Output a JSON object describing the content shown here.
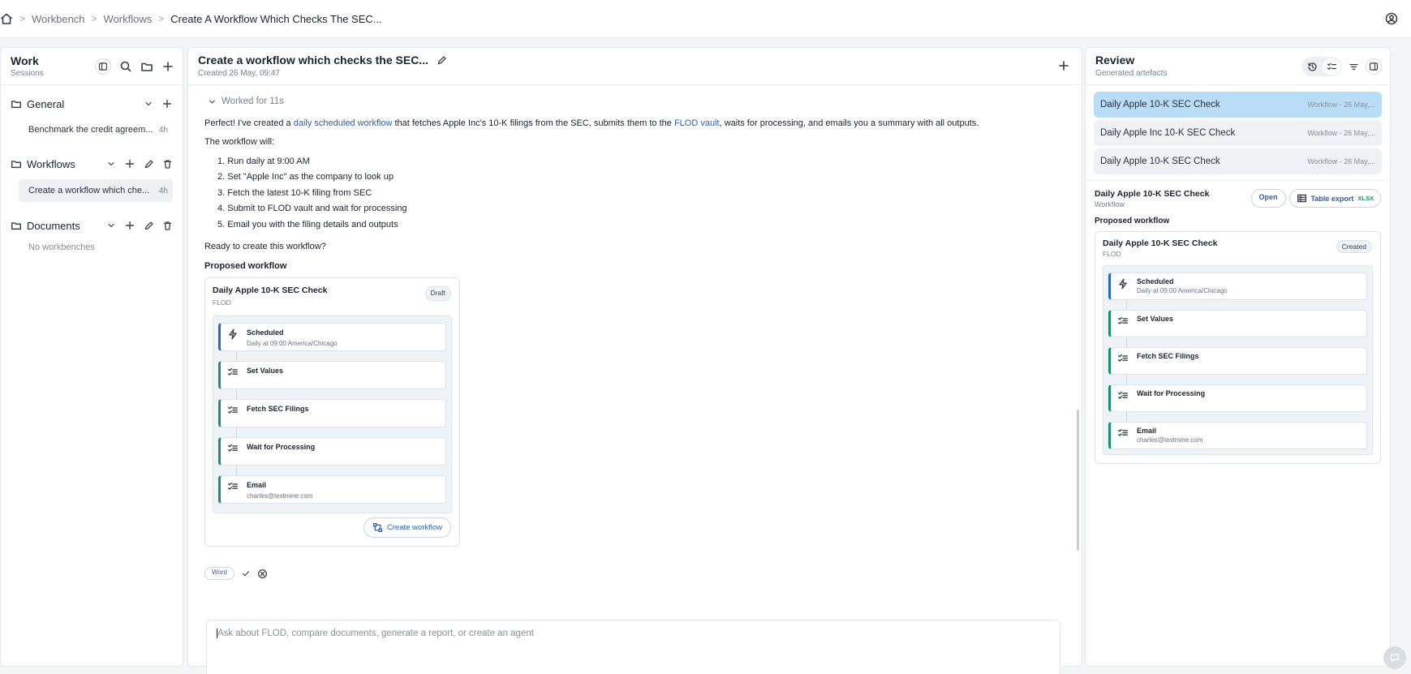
{
  "breadcrumb": {
    "items": [
      "Workbench",
      "Workflows"
    ],
    "current": "Create A Workflow Which Checks The SEC..."
  },
  "left": {
    "title": "Work",
    "subtitle": "Sessions",
    "sections": [
      {
        "name": "General",
        "items": [
          {
            "title": "Benchmark the credit agreem...",
            "age": "4h"
          }
        ]
      },
      {
        "name": "Workflows",
        "items": [
          {
            "title": "Create a workflow which che...",
            "age": "4h"
          }
        ]
      },
      {
        "name": "Documents",
        "empty": "No workbenches"
      }
    ]
  },
  "main": {
    "title": "Create a workflow which checks the SEC...",
    "created": "Created 26 May, 09:47",
    "worked": "Worked for 11s",
    "msg": {
      "intro_a": "Perfect! I've created a ",
      "intro_hl1": "daily scheduled workflow",
      "intro_b": " that fetches Apple Inc's 10-K filings from the SEC, submits them to the ",
      "intro_hl2": "FLOD vault",
      "intro_c": ", waits for processing, and emails you a summary with all outputs.",
      "will": "The workflow will:",
      "steps": [
        "1. Run daily at 9:00 AM",
        "2. Set \"Apple Inc\" as the company to look up",
        "3. Fetch the latest 10-K filing from SEC",
        "4. Submit to FLOD vault and wait for processing",
        "5. Email you with the filing details and outputs"
      ],
      "ready": "Ready to create this workflow?",
      "proposed": "Proposed workflow"
    },
    "workflow": {
      "name": "Daily Apple 10-K SEC Check",
      "org": "FLOD",
      "badge": "Draft",
      "nodes": [
        {
          "title": "Scheduled",
          "sub": "Daily at 09:00 America/Chicago"
        },
        {
          "title": "Set Values",
          "sub": ""
        },
        {
          "title": "Fetch SEC Filings",
          "sub": ""
        },
        {
          "title": "Wait for Processing",
          "sub": ""
        },
        {
          "title": "Email",
          "sub": "charles@textmine.com"
        }
      ],
      "create_label": "Create workflow"
    },
    "mini_label": "Word",
    "composer_placeholder": "Ask about FLOD, compare documents, generate a report, or create an agent"
  },
  "review": {
    "title": "Review",
    "subtitle": "Generated artefacts",
    "artefacts": [
      {
        "title": "Daily Apple 10-K SEC Check",
        "meta": "Workflow - 26 May,..."
      },
      {
        "title": "Daily Apple Inc 10-K SEC Check",
        "meta": "Workflow - 26 May,..."
      },
      {
        "title": "Daily Apple 10-K SEC Check",
        "meta": "Workflow - 26 May,..."
      }
    ],
    "detail": {
      "name": "Daily Apple 10-K SEC Check",
      "type": "Workflow",
      "open": "Open",
      "export": "Table export",
      "export_fmt": "XLSX",
      "proposed": "Proposed workflow",
      "workflow": {
        "name": "Daily Apple 10-K SEC Check",
        "org": "FLOD",
        "badge": "Created",
        "nodes": [
          {
            "title": "Scheduled",
            "sub": "Daily at 09:00 America/Chicago"
          },
          {
            "title": "Set Values",
            "sub": ""
          },
          {
            "title": "Fetch SEC Filings",
            "sub": ""
          },
          {
            "title": "Wait for Processing",
            "sub": ""
          },
          {
            "title": "Email",
            "sub": "charles@textmine.com"
          }
        ]
      }
    }
  }
}
